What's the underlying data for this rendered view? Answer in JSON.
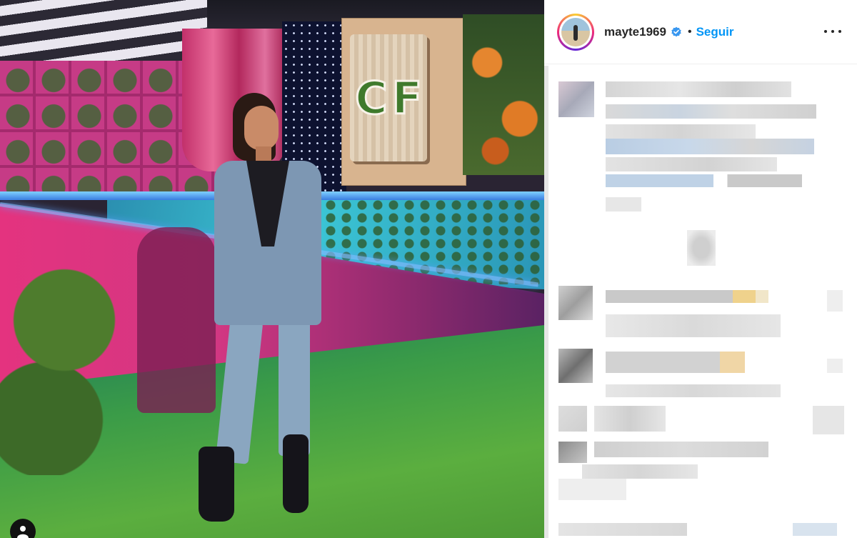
{
  "post": {
    "username": "mayte1969",
    "separator": "•",
    "follow_label": "Seguir",
    "verified_icon": "verified-badge-icon",
    "more_icon": "more-options-icon",
    "sign_text": {
      "left": "C",
      "right": "F"
    }
  },
  "colors": {
    "follow_blue": "#0095f6",
    "verified_blue": "#3897f0",
    "text": "#262626"
  }
}
